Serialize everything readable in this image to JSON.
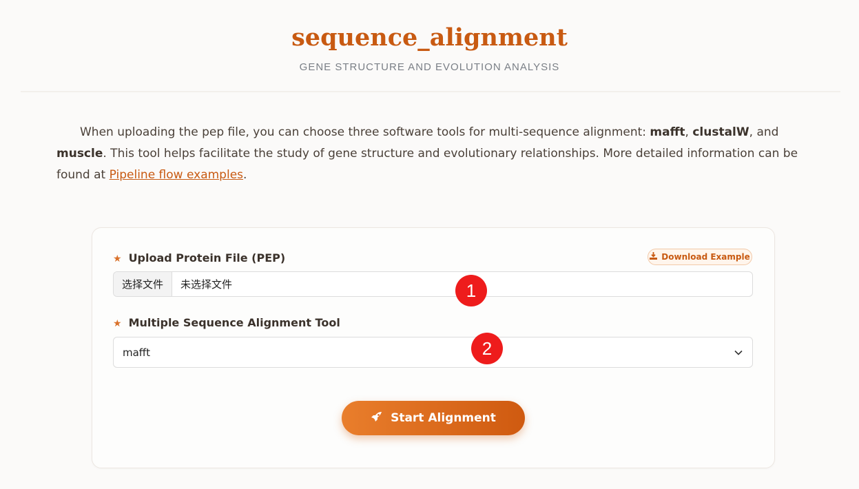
{
  "header": {
    "title": "sequence_alignment",
    "subtitle": "GENE STRUCTURE AND EVOLUTION ANALYSIS"
  },
  "description": {
    "text_before": "When uploading the pep file, you can choose three software tools for multi-sequence alignment: ",
    "tool1": "mafft",
    "sep1": ", ",
    "tool2": "clustalW",
    "sep2": ", and ",
    "tool3": "muscle",
    "text_after": ". This tool helps facilitate the study of gene structure and evolutionary relationships. More detailed information can be found at ",
    "link_text": "Pipeline flow examples",
    "end": "."
  },
  "form": {
    "upload_label": "Upload Protein File (PEP)",
    "download_example": "Download Example",
    "file_button": "选择文件",
    "file_status": "未选择文件",
    "tool_label": "Multiple Sequence Alignment Tool",
    "tool_selected": "mafft",
    "submit_label": "Start Alignment"
  },
  "annotations": {
    "marker1": "1",
    "marker2": "2"
  },
  "icons": {
    "required": "star-icon",
    "download": "download-icon",
    "dropdown": "chevron-down-icon",
    "submit": "rocket-icon"
  },
  "colors": {
    "accent": "#c85a12",
    "marker": "#ee1c1c"
  }
}
